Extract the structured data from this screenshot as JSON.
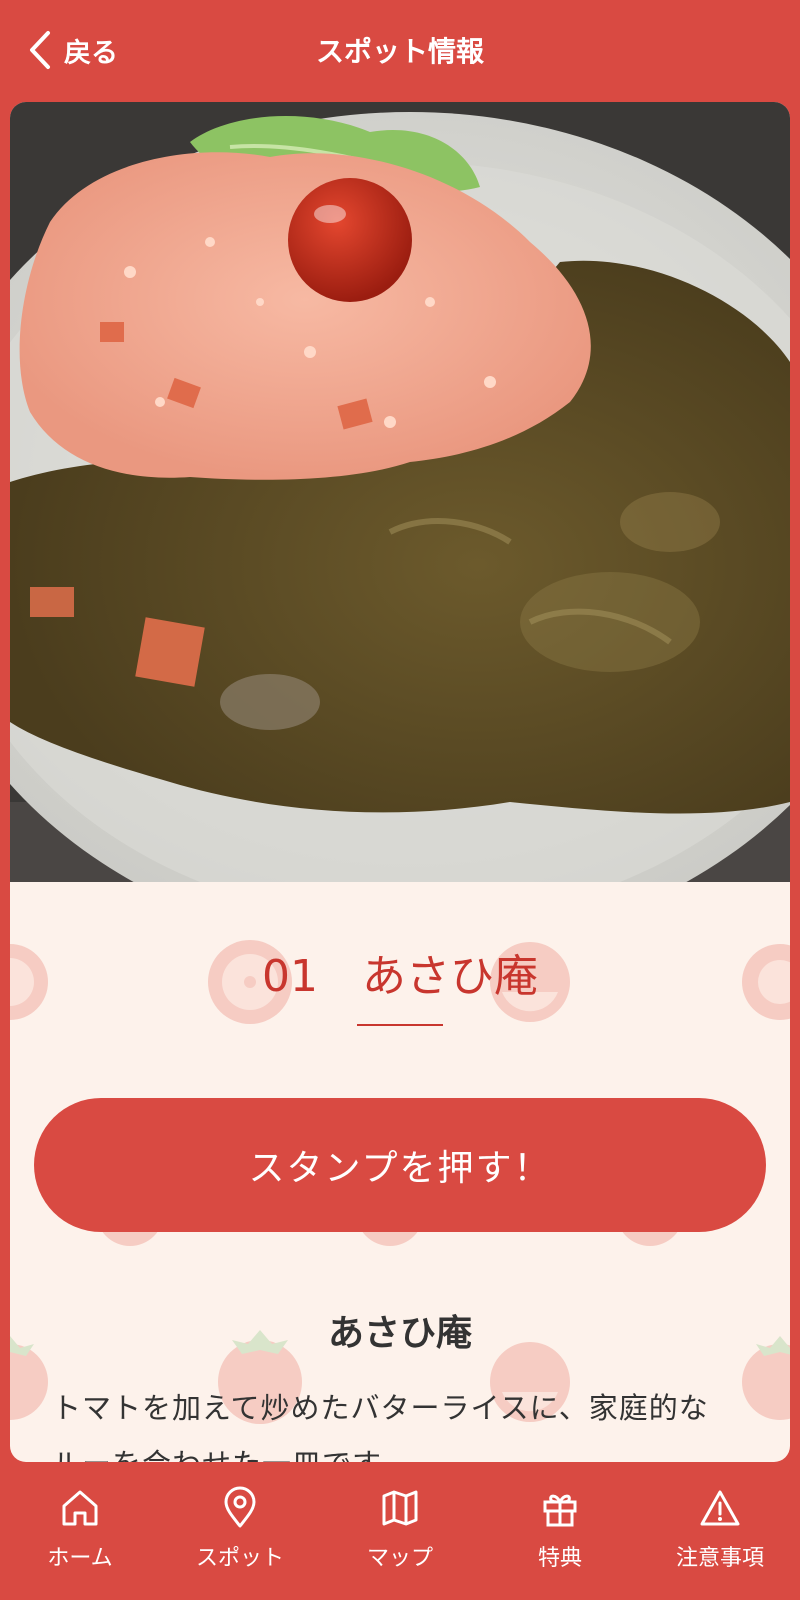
{
  "header": {
    "back_label": "戻る",
    "title": "スポット情報"
  },
  "spot": {
    "number": "01",
    "name": "あさひ庵"
  },
  "stamp_button": {
    "label": "スタンプを押す！"
  },
  "description": {
    "title": "あさひ庵",
    "text": "トマトを加えて炒めたバターライスに、家庭的なルーを合わせた一皿です。"
  },
  "nav": [
    {
      "label": "ホーム",
      "icon": "home-icon"
    },
    {
      "label": "スポット",
      "icon": "location-pin-icon"
    },
    {
      "label": "マップ",
      "icon": "map-icon"
    },
    {
      "label": "特典",
      "icon": "gift-icon"
    },
    {
      "label": "注意事項",
      "icon": "warning-icon"
    }
  ],
  "colors": {
    "accent": "#d94a42",
    "card_bg": "#fdf2eb",
    "spot_text": "#c8362e"
  }
}
